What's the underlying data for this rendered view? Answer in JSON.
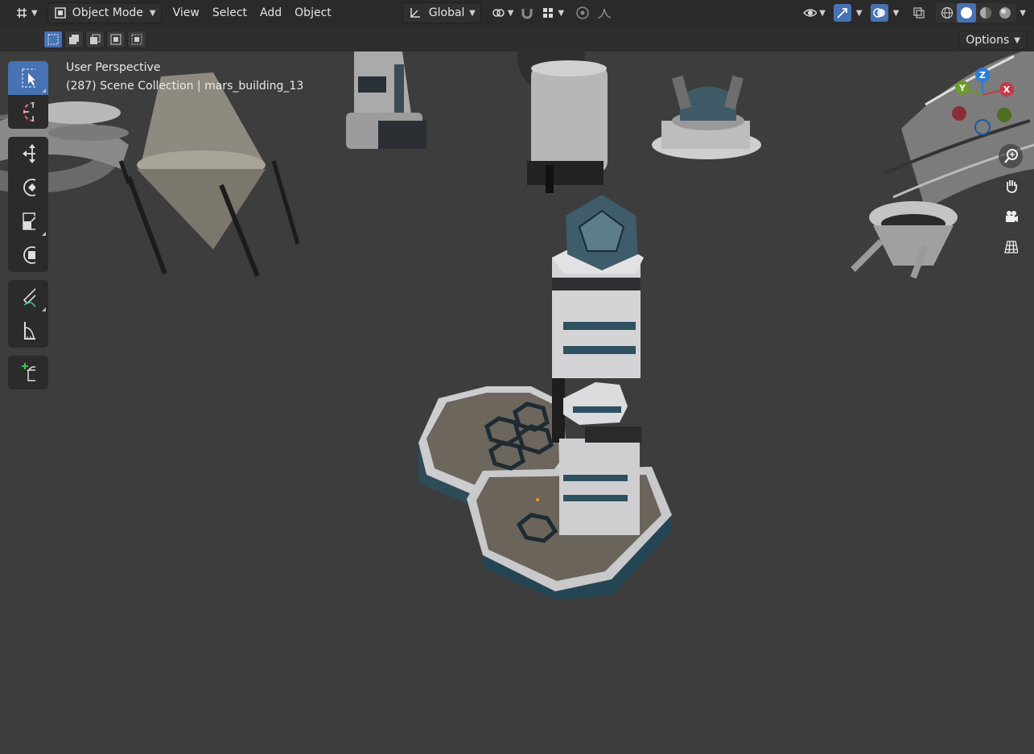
{
  "header": {
    "editor_type_icon": "grid-editor-icon",
    "mode_label": "Object Mode",
    "menus": [
      "View",
      "Select",
      "Add",
      "Object"
    ],
    "transform_orientation": "Global",
    "options_label": "Options"
  },
  "viewport": {
    "perspective_label": "User Perspective",
    "collection_label": "(287) Scene Collection | mars_building_13"
  },
  "gizmo": {
    "x_label": "X",
    "y_label": "Y",
    "z_label": "Z",
    "x_color": "#c33b4a",
    "y_color": "#6a9c28",
    "z_color": "#2c7bd8"
  },
  "tools": [
    "select-box",
    "cursor",
    "move",
    "rotate",
    "scale",
    "transform",
    "annotate",
    "measure",
    "add-cube"
  ],
  "colors": {
    "accent": "#4772b3",
    "background": "#3d3d3d",
    "header": "#2a2a2a"
  }
}
